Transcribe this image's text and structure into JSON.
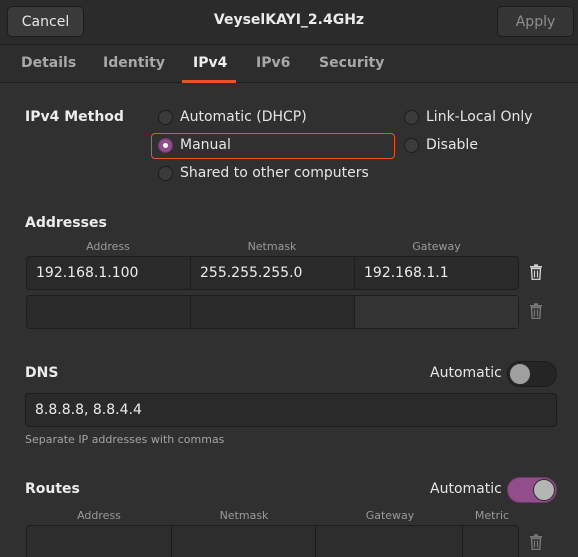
{
  "header": {
    "cancel_label": "Cancel",
    "title": "VeyselKAYI_2.4GHz",
    "apply_label": "Apply"
  },
  "tabs": [
    {
      "label": "Details"
    },
    {
      "label": "Identity"
    },
    {
      "label": "IPv4"
    },
    {
      "label": "IPv6"
    },
    {
      "label": "Security"
    }
  ],
  "active_tab": "IPv4",
  "ipv4_method": {
    "label": "IPv4 Method",
    "options": {
      "automatic_dhcp": "Automatic (DHCP)",
      "manual": "Manual",
      "shared": "Shared to other computers",
      "link_local": "Link-Local Only",
      "disable": "Disable"
    },
    "selected": "Manual"
  },
  "addresses": {
    "title": "Addresses",
    "columns": [
      "Address",
      "Netmask",
      "Gateway"
    ],
    "rows": [
      {
        "address": "192.168.1.100",
        "netmask": "255.255.255.0",
        "gateway": "192.168.1.1"
      },
      {
        "address": "",
        "netmask": "",
        "gateway": ""
      }
    ]
  },
  "dns": {
    "title": "DNS",
    "automatic_label": "Automatic",
    "automatic_on": false,
    "value": "8.8.8.8, 8.8.4.4",
    "hint": "Separate IP addresses with commas"
  },
  "routes": {
    "title": "Routes",
    "automatic_label": "Automatic",
    "automatic_on": true,
    "columns": [
      "Address",
      "Netmask",
      "Gateway",
      "Metric"
    ]
  },
  "colors": {
    "accent_orange": "#e95420",
    "selected_purple": "#924d8b"
  }
}
